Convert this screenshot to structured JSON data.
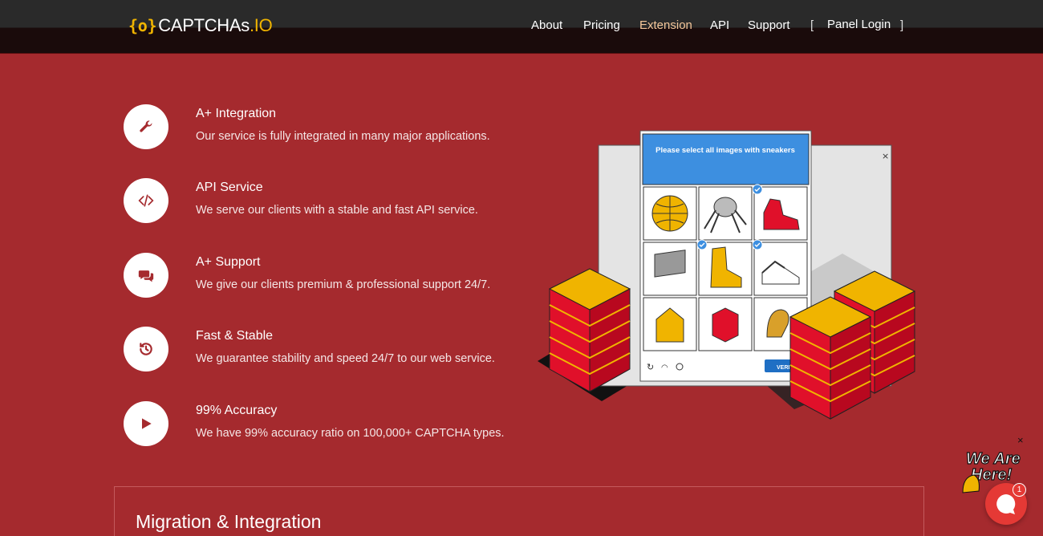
{
  "brand": {
    "logo_mark": "{o}",
    "name": "CAPTCHAs",
    "tld": ".IO"
  },
  "nav": {
    "items": [
      {
        "label": "About"
      },
      {
        "label": "Pricing"
      },
      {
        "label": "Extension",
        "active": true
      },
      {
        "label": "API"
      },
      {
        "label": "Support"
      },
      {
        "label": "Panel Login"
      }
    ],
    "bracket_open": "[",
    "bracket_close": "]"
  },
  "features": [
    {
      "icon": "wrench-icon",
      "title": "A+ Integration",
      "desc": "Our service is fully integrated in many major applications."
    },
    {
      "icon": "code-icon",
      "title": "API Service",
      "desc": "We serve our clients with a stable and fast API service."
    },
    {
      "icon": "chat-icon",
      "title": "A+ Support",
      "desc": "We give our clients premium & professional support 24/7."
    },
    {
      "icon": "history-icon",
      "title": "Fast & Stable",
      "desc": "We guarantee stability and speed 24/7 to our web service."
    },
    {
      "icon": "play-icon",
      "title": "99% Accuracy",
      "desc": "We have 99% accuracy ratio on 100,000+ CAPTCHA types."
    }
  ],
  "captcha": {
    "prompt": "Please select all images with sneakers",
    "close": "×",
    "verify": "VERIFY"
  },
  "section": {
    "title": "Migration & Integration"
  },
  "chat": {
    "close": "×",
    "badge": "1",
    "banner_line1": "We Are",
    "banner_line2": "Here!"
  },
  "colors": {
    "background": "#a52a2e",
    "accent": "#f0b400",
    "active_nav": "#f5c79a",
    "captcha_blue": "#3d8fe0",
    "server_red": "#e0102a"
  }
}
